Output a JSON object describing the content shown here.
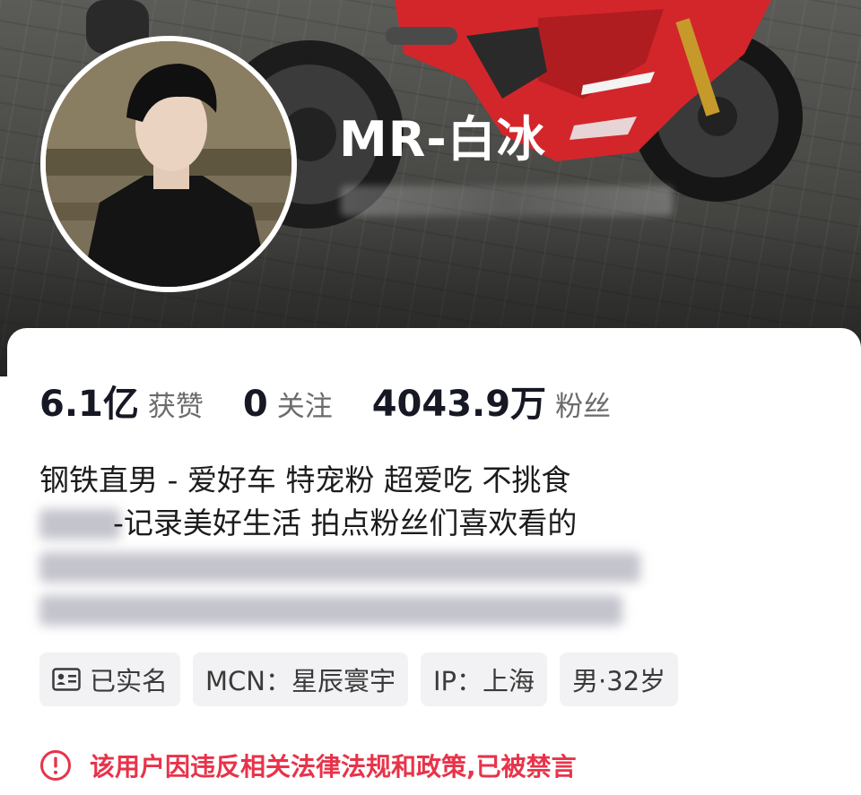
{
  "profile": {
    "nickname": "MR-白冰"
  },
  "stats": [
    {
      "value": "6.1亿",
      "label": "获赞"
    },
    {
      "value": "0",
      "label": "关注"
    },
    {
      "value": "4043.9万",
      "label": "粉丝"
    }
  ],
  "bio": {
    "line1": "钢铁直男 - 爱好车 特宠粉 超爱吃 不挑食",
    "line2": "-记录美好生活 拍点粉丝们喜欢看的"
  },
  "tags": {
    "verified": "已实名",
    "mcn": "MCN：星辰寰宇",
    "ip": "IP：上海",
    "gender_age": "男·32岁"
  },
  "ban_notice": "该用户因违反相关法律法规和政策,已被禁言",
  "colors": {
    "ban_red": "#e8334a",
    "tag_bg": "#f2f2f4",
    "text_dark": "#161823"
  }
}
